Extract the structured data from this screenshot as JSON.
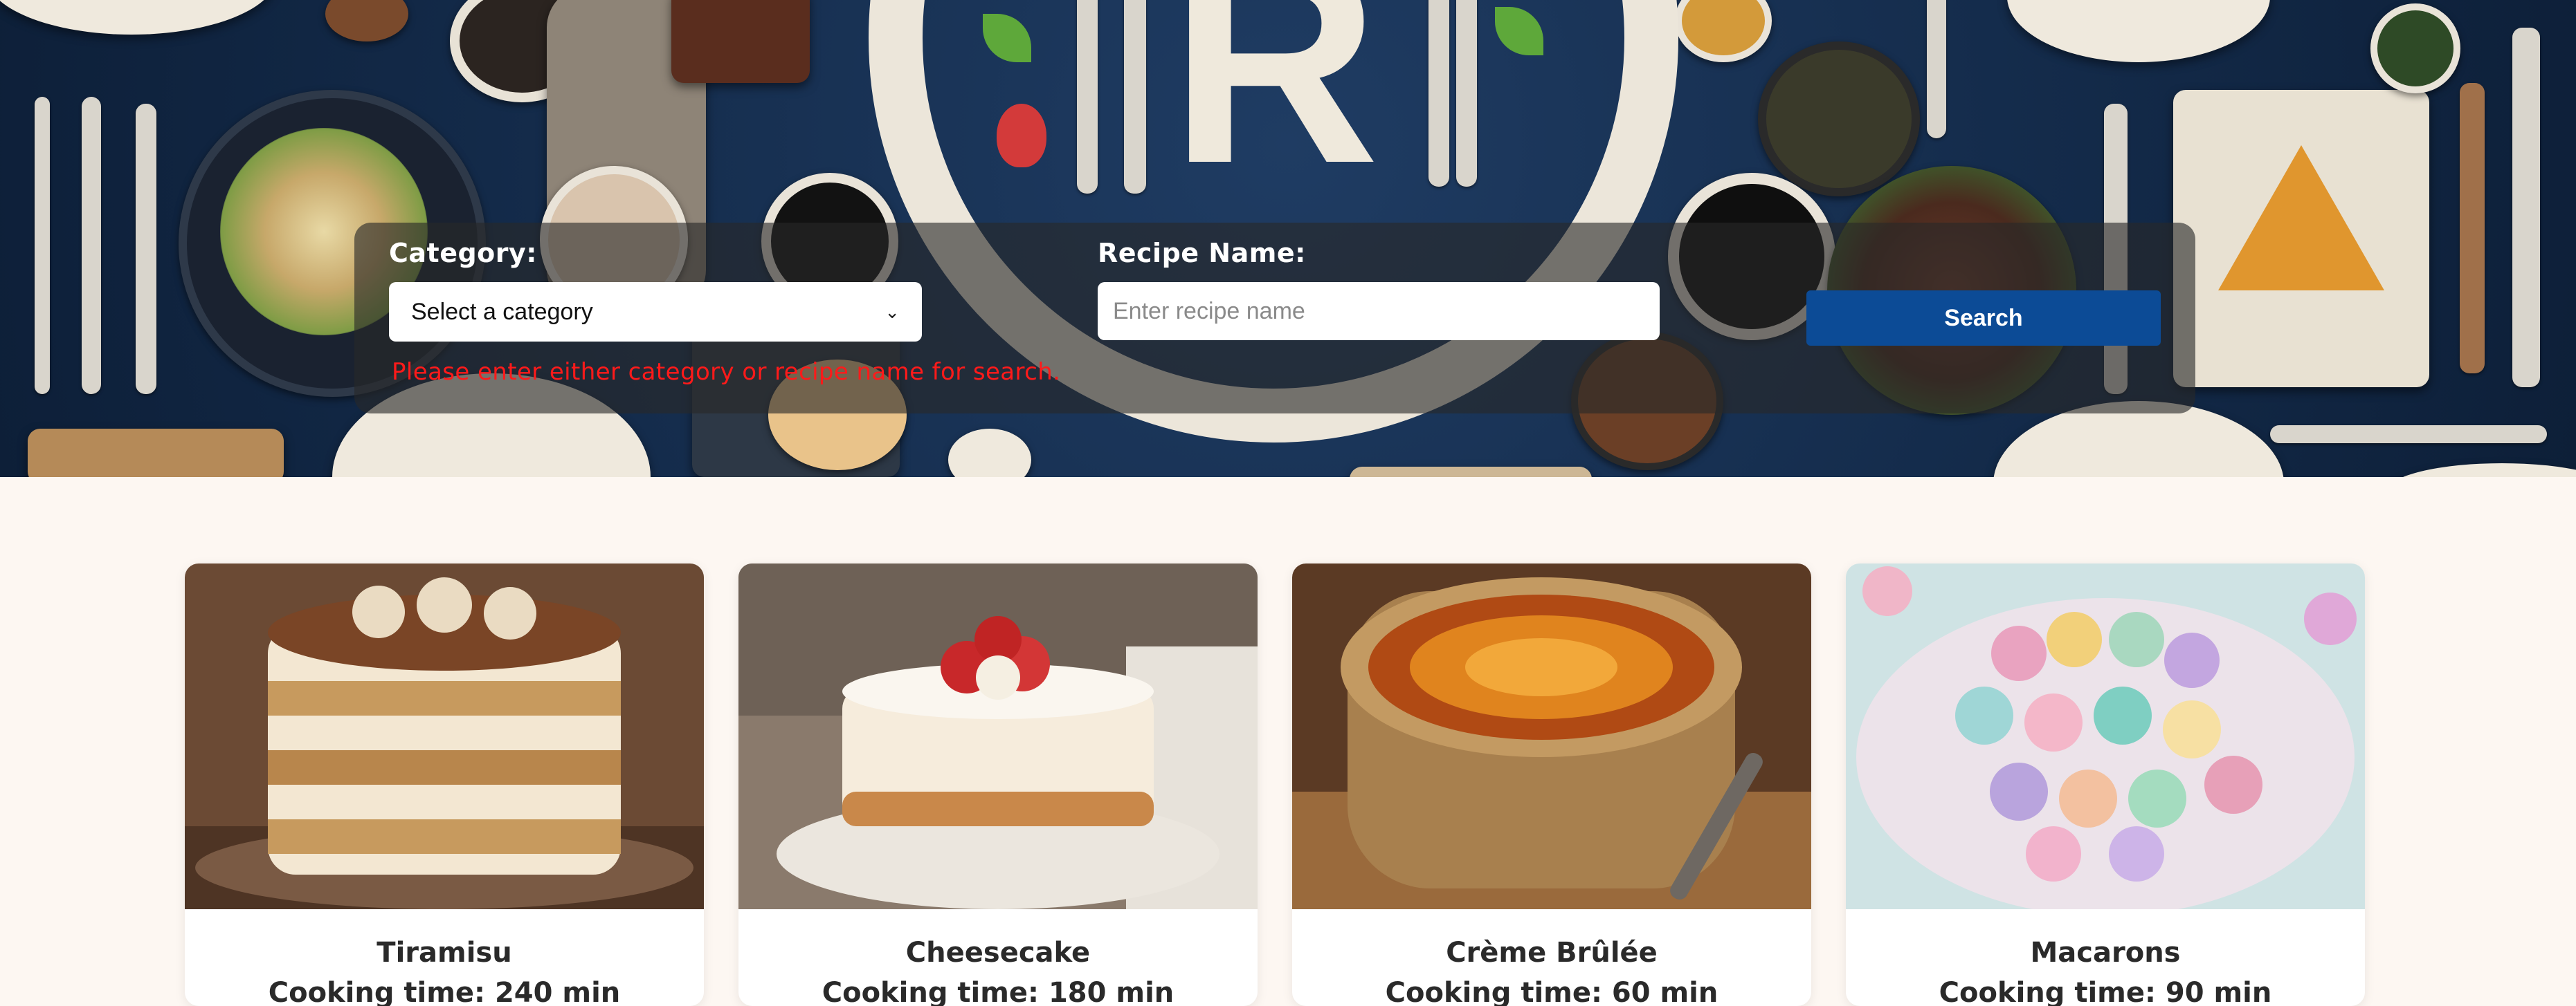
{
  "search": {
    "category_label": "Category:",
    "category_selected": "Select a category",
    "recipe_label": "Recipe Name:",
    "recipe_placeholder": "Enter recipe name",
    "button_label": "Search",
    "error_message": "Please enter either category or recipe name for search."
  },
  "logo": {
    "letter": "R"
  },
  "recipes": [
    {
      "name": "Tiramisu",
      "cooking_time": "Cooking time: 240 min"
    },
    {
      "name": "Cheesecake",
      "cooking_time": "Cooking time: 180 min"
    },
    {
      "name": "Crème Brûlée",
      "cooking_time": "Cooking time: 60 min"
    },
    {
      "name": "Macarons",
      "cooking_time": "Cooking time: 90 min"
    }
  ],
  "colors": {
    "page_background": "#fdf7f2",
    "hero_background": "#132a49",
    "search_button": "#0c4b96",
    "error_text": "#ff1a1a"
  }
}
